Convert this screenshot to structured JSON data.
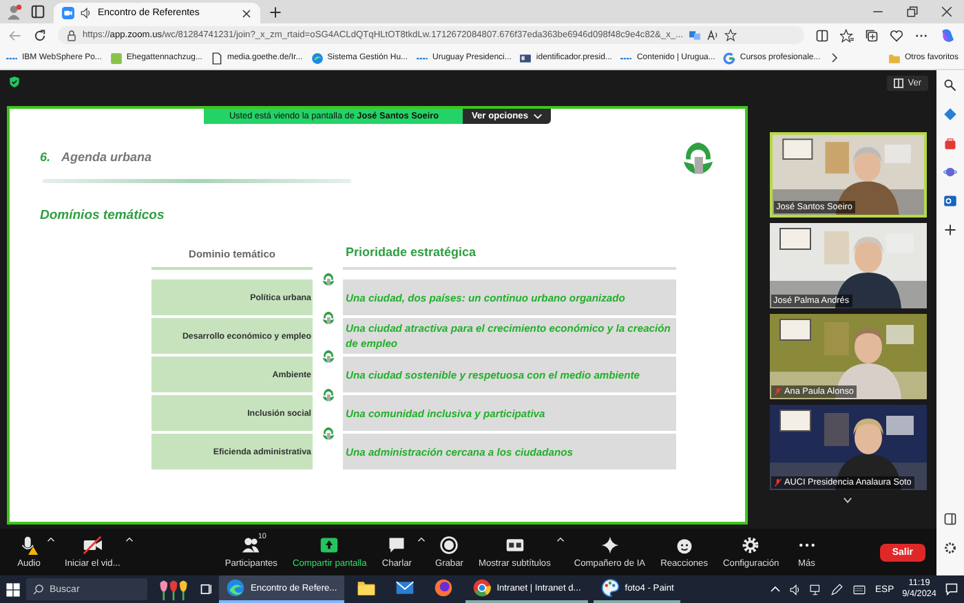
{
  "browser": {
    "tab": {
      "title": "Encontro de Referentes",
      "selected": true
    },
    "url": {
      "host": "https://app.zoom.us",
      "path": "/wc/81284741231/join?_x_zm_rtaid=oSG4ACLdQTqHLtOT8tkdLw.1712672084807.676f37eda363be6946d098f48c9e4c82&_x_..."
    },
    "bookmarks": [
      {
        "label": "IBM WebSphere Po..."
      },
      {
        "label": "Ehegattennachzug..."
      },
      {
        "label": "media.goethe.de/Ir..."
      },
      {
        "label": "Sistema Gestión Hu..."
      },
      {
        "label": "Uruguay Presidenci..."
      },
      {
        "label": "identificador.presid..."
      },
      {
        "label": "Contenido | Urugua..."
      },
      {
        "label": "Cursos profesionale..."
      }
    ],
    "other_favorites": "Otros favoritos"
  },
  "meeting": {
    "view_button": "Ver",
    "banner": {
      "text": "Usted está viendo la pantalla de **José Santos Soeiro**",
      "options": "Ver opciones"
    },
    "slide": {
      "number": "6.",
      "title": "Agenda urbana",
      "subtitle": "Domínios temáticos",
      "column_headers": [
        "Dominio temático",
        "Prioridade estratégica"
      ],
      "rows": [
        {
          "domain": "Política urbana",
          "priority": "Una ciudad, dos países: un continuo urbano organizado"
        },
        {
          "domain": "Desarrollo económico y empleo",
          "priority": "Una ciudad atractiva para el crecimiento económico y la creación de empleo"
        },
        {
          "domain": "Ambiente",
          "priority": "Una ciudad sostenible y respetuosa con el medio ambiente"
        },
        {
          "domain": "Inclusión social",
          "priority": "Una comunidad inclusiva y participativa"
        },
        {
          "domain": "Eficienda administrativa",
          "priority": "Una administración cercana a los ciudadanos"
        }
      ]
    },
    "participants": [
      {
        "name": "José Santos Soeiro",
        "active_speaker": true,
        "muted": false
      },
      {
        "name": "José Palma Andrés",
        "active_speaker": false,
        "muted": false
      },
      {
        "name": "Ana Paula Alonso",
        "active_speaker": false,
        "muted": true
      },
      {
        "name": "AUCI Presidencia Analaura Soto",
        "active_speaker": false,
        "muted": true
      }
    ],
    "toolbar": [
      {
        "label": "Audio",
        "has_menu": true,
        "active": false
      },
      {
        "label": "Iniciar el vid...",
        "has_menu": true,
        "active": false
      },
      {
        "label": "Participantes",
        "count": "10",
        "has_menu": false,
        "active": false
      },
      {
        "label": "Compartir pantalla",
        "has_menu": false,
        "active": true
      },
      {
        "label": "Charlar",
        "has_menu": true,
        "active": false
      },
      {
        "label": "Grabar",
        "has_menu": false,
        "active": false
      },
      {
        "label": "Mostrar subtítulos",
        "has_menu": true,
        "active": false
      },
      {
        "label": "Compañero de IA",
        "has_menu": false,
        "active": false
      },
      {
        "label": "Reacciones",
        "has_menu": false,
        "active": false
      },
      {
        "label": "Configuración",
        "has_menu": false,
        "active": false
      },
      {
        "label": "Más",
        "has_menu": false,
        "active": false
      }
    ],
    "leave_button": "Salir"
  },
  "taskbar": {
    "search_placeholder": "Buscar",
    "apps": [
      {
        "kind": "edge",
        "label": "Encontro de Refere...",
        "selected": true
      },
      {
        "kind": "folder",
        "selected": false
      },
      {
        "kind": "mail",
        "selected": false
      },
      {
        "kind": "firefox",
        "selected": false
      },
      {
        "kind": "chrome",
        "label": "Intranet | Intranet d...",
        "selected": false
      },
      {
        "kind": "paint",
        "label": "foto4 - Paint",
        "selected": false
      }
    ],
    "language": "ESP",
    "time": "11:19",
    "date": "9/4/2024"
  }
}
